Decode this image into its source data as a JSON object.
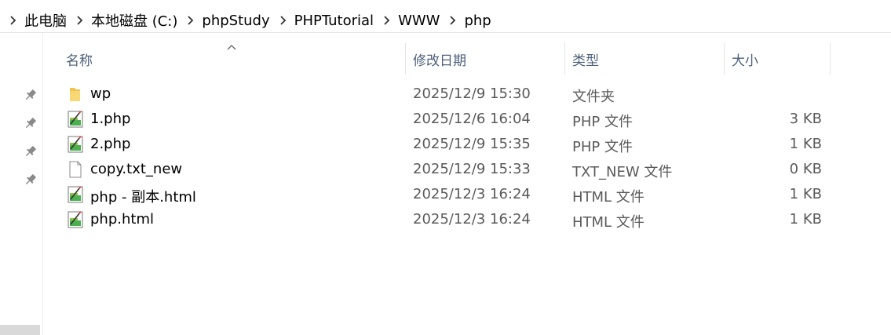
{
  "breadcrumb": {
    "items": [
      {
        "label": "此电脑"
      },
      {
        "label": "本地磁盘 (C:)"
      },
      {
        "label": "phpStudy"
      },
      {
        "label": "PHPTutorial"
      },
      {
        "label": "WWW"
      },
      {
        "label": "php"
      }
    ]
  },
  "columns": {
    "name": "名称",
    "date_modified": "修改日期",
    "type": "类型",
    "size": "大小"
  },
  "sort": {
    "column": "name",
    "direction": "ascending",
    "icon": "chevron-up-icon"
  },
  "nav_pane": {
    "pins": [
      "pin-icon",
      "pin-icon",
      "pin-icon",
      "pin-icon"
    ]
  },
  "files": [
    {
      "name": "wp",
      "date": "2025/12/9 15:30",
      "type": "文件夹",
      "size": "",
      "icon": "folder-icon"
    },
    {
      "name": "1.php",
      "date": "2025/12/6 16:04",
      "type": "PHP 文件",
      "size": "3 KB",
      "icon": "script-file-icon"
    },
    {
      "name": "2.php",
      "date": "2025/12/9 15:35",
      "type": "PHP 文件",
      "size": "1 KB",
      "icon": "script-file-icon"
    },
    {
      "name": "copy.txt_new",
      "date": "2025/12/9 15:33",
      "type": "TXT_NEW 文件",
      "size": "0 KB",
      "icon": "blank-file-icon"
    },
    {
      "name": "php - 副本.html",
      "date": "2025/12/3 16:24",
      "type": "HTML 文件",
      "size": "1 KB",
      "icon": "script-file-icon"
    },
    {
      "name": "php.html",
      "date": "2025/12/3 16:24",
      "type": "HTML 文件",
      "size": "1 KB",
      "icon": "script-file-icon"
    }
  ],
  "colors": {
    "header_text": "#4c607a",
    "secondary_text": "#5a5a5a",
    "folder": "#f2c14e",
    "script_icon_green": "#4caf50"
  }
}
